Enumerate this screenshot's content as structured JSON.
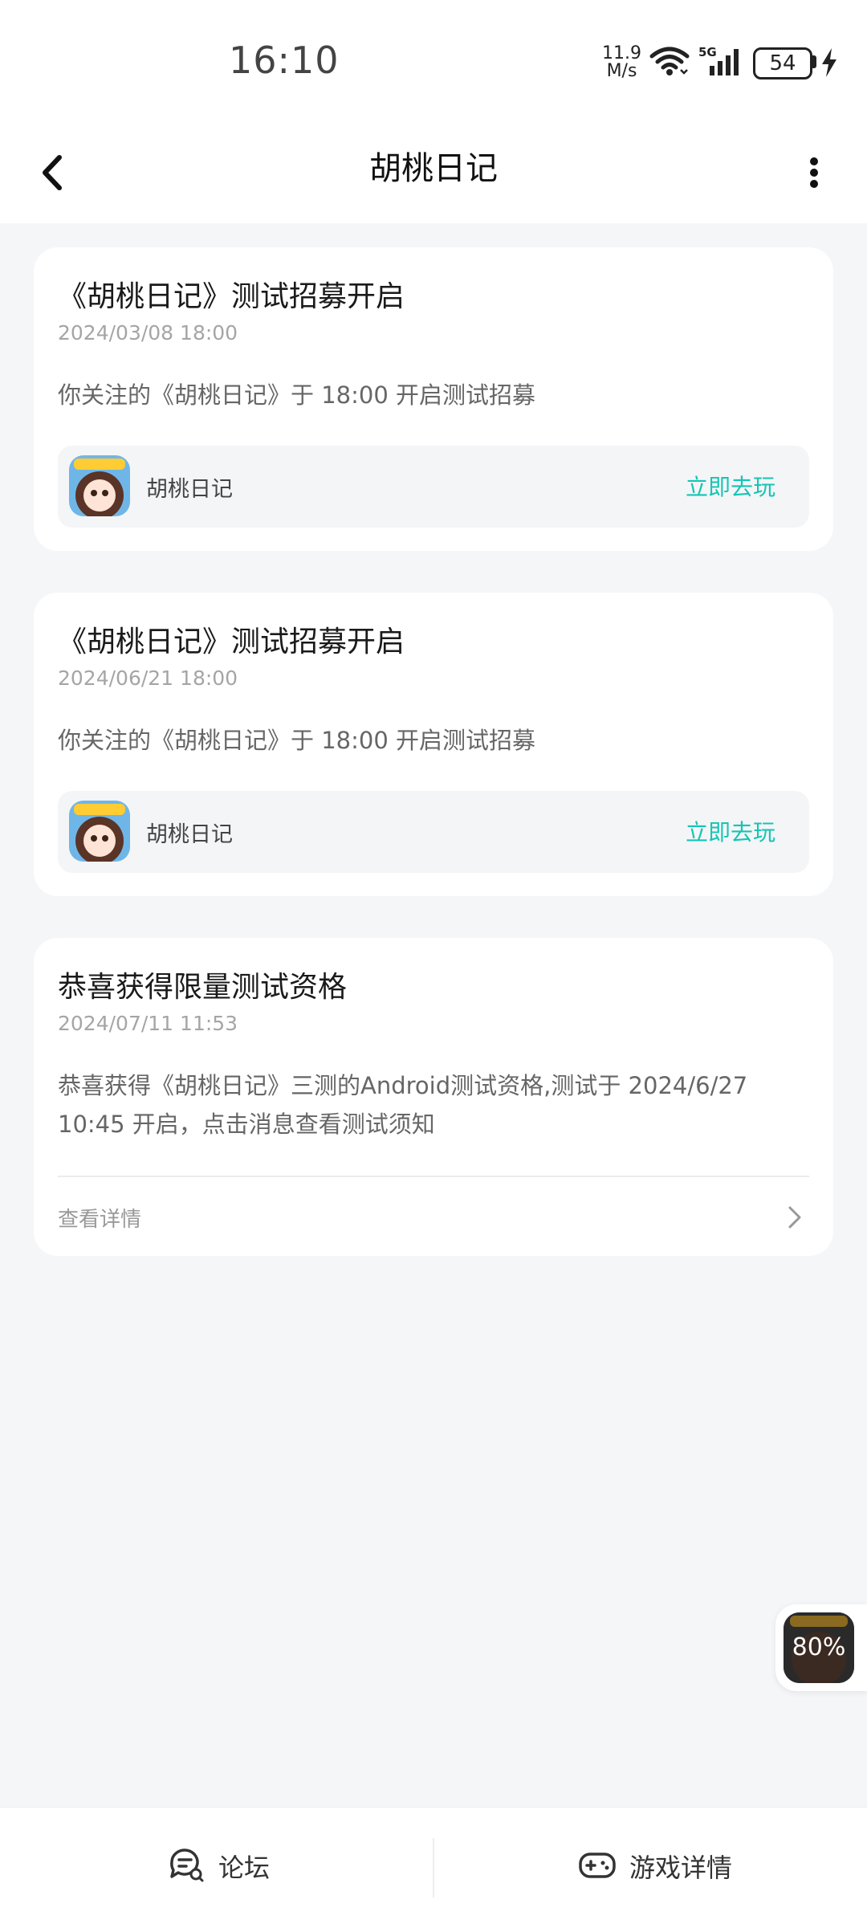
{
  "status": {
    "time": "16:10",
    "net_speed_top": "11.9",
    "net_speed_bottom": "M/s",
    "signal_label": "5G",
    "battery": "54"
  },
  "header": {
    "title": "胡桃日记"
  },
  "cards": [
    {
      "title": "《胡桃日记》测试招募开启",
      "date": "2024/03/08 18:00",
      "body": "你关注的《胡桃日记》于 18:00 开启测试招募",
      "game_name": "胡桃日记",
      "action": "立即去玩"
    },
    {
      "title": "《胡桃日记》测试招募开启",
      "date": "2024/06/21 18:00",
      "body": "你关注的《胡桃日记》于 18:00 开启测试招募",
      "game_name": "胡桃日记",
      "action": "立即去玩"
    },
    {
      "title": "恭喜获得限量测试资格",
      "date": "2024/07/11 11:53",
      "body": "恭喜获得《胡桃日记》三测的Android测试资格,测试于 2024/6/27 10:45 开启，点击消息查看测试须知",
      "link": "查看详情"
    }
  ],
  "floating": {
    "progress_text": "80%",
    "progress_value": 80
  },
  "bottom_tabs": {
    "forum": "论坛",
    "game_detail": "游戏详情"
  },
  "colors": {
    "accent": "#15c5b4",
    "background": "#f5f6f8"
  },
  "icons": [
    "back-arrow-icon",
    "more-vertical-icon",
    "chevron-right-icon",
    "forum-chat-icon",
    "gamepad-icon",
    "wifi-icon",
    "cell-signal-icon",
    "battery-icon",
    "charging-bolt-icon"
  ]
}
